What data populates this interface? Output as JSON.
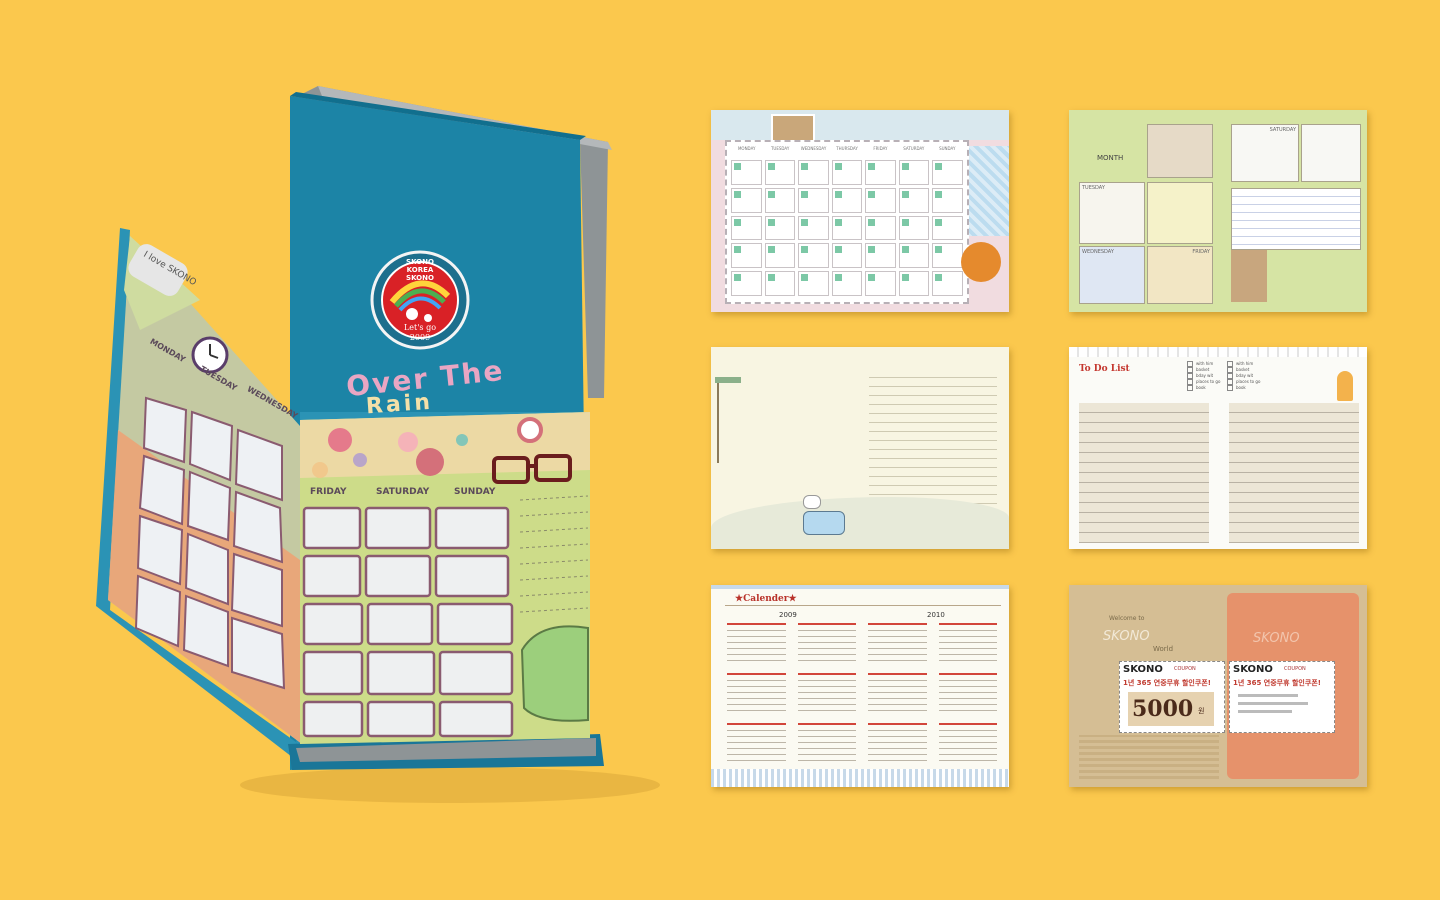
{
  "book": {
    "badge_ring_text": "SKONO KOREA SKONO",
    "badge_center_text": "Let's go",
    "badge_year": "2009",
    "cover_title_line1": "Over The",
    "cover_title_line2": "Rain",
    "tab_text": "I love SKONO",
    "weekdays_left": [
      "MONDAY",
      "TUESDAY",
      "WEDNESDAY"
    ],
    "weekdays_right": [
      "FRIDAY",
      "SATURDAY",
      "SUNDAY"
    ]
  },
  "thumbnails": {
    "monthly": {
      "days": [
        "MONDAY",
        "TUESDAY",
        "WEDNESDAY",
        "THURSDAY",
        "FRIDAY",
        "SATURDAY",
        "SUNDAY"
      ]
    },
    "weekly": {
      "month_label": "MONTH",
      "labels": [
        "TUESDAY",
        "SATURDAY",
        "WEDNESDAY",
        "FRIDAY"
      ]
    },
    "notes": {},
    "todo": {
      "title": "To Do List",
      "checks": [
        "with him",
        "basket",
        "bday wit",
        "places to go",
        "book"
      ]
    },
    "calendar": {
      "title": "★Calender★",
      "years": [
        "2009",
        "2010"
      ]
    },
    "coupon": {
      "brand": "SKONO",
      "coupon_label": "COUPON",
      "offer": "1년 365 연중무휴 할인쿠폰!",
      "amount": "5000",
      "amount_unit": "원",
      "brand_script": "SKONO",
      "welcome": "Welcome to",
      "world": "World"
    }
  }
}
